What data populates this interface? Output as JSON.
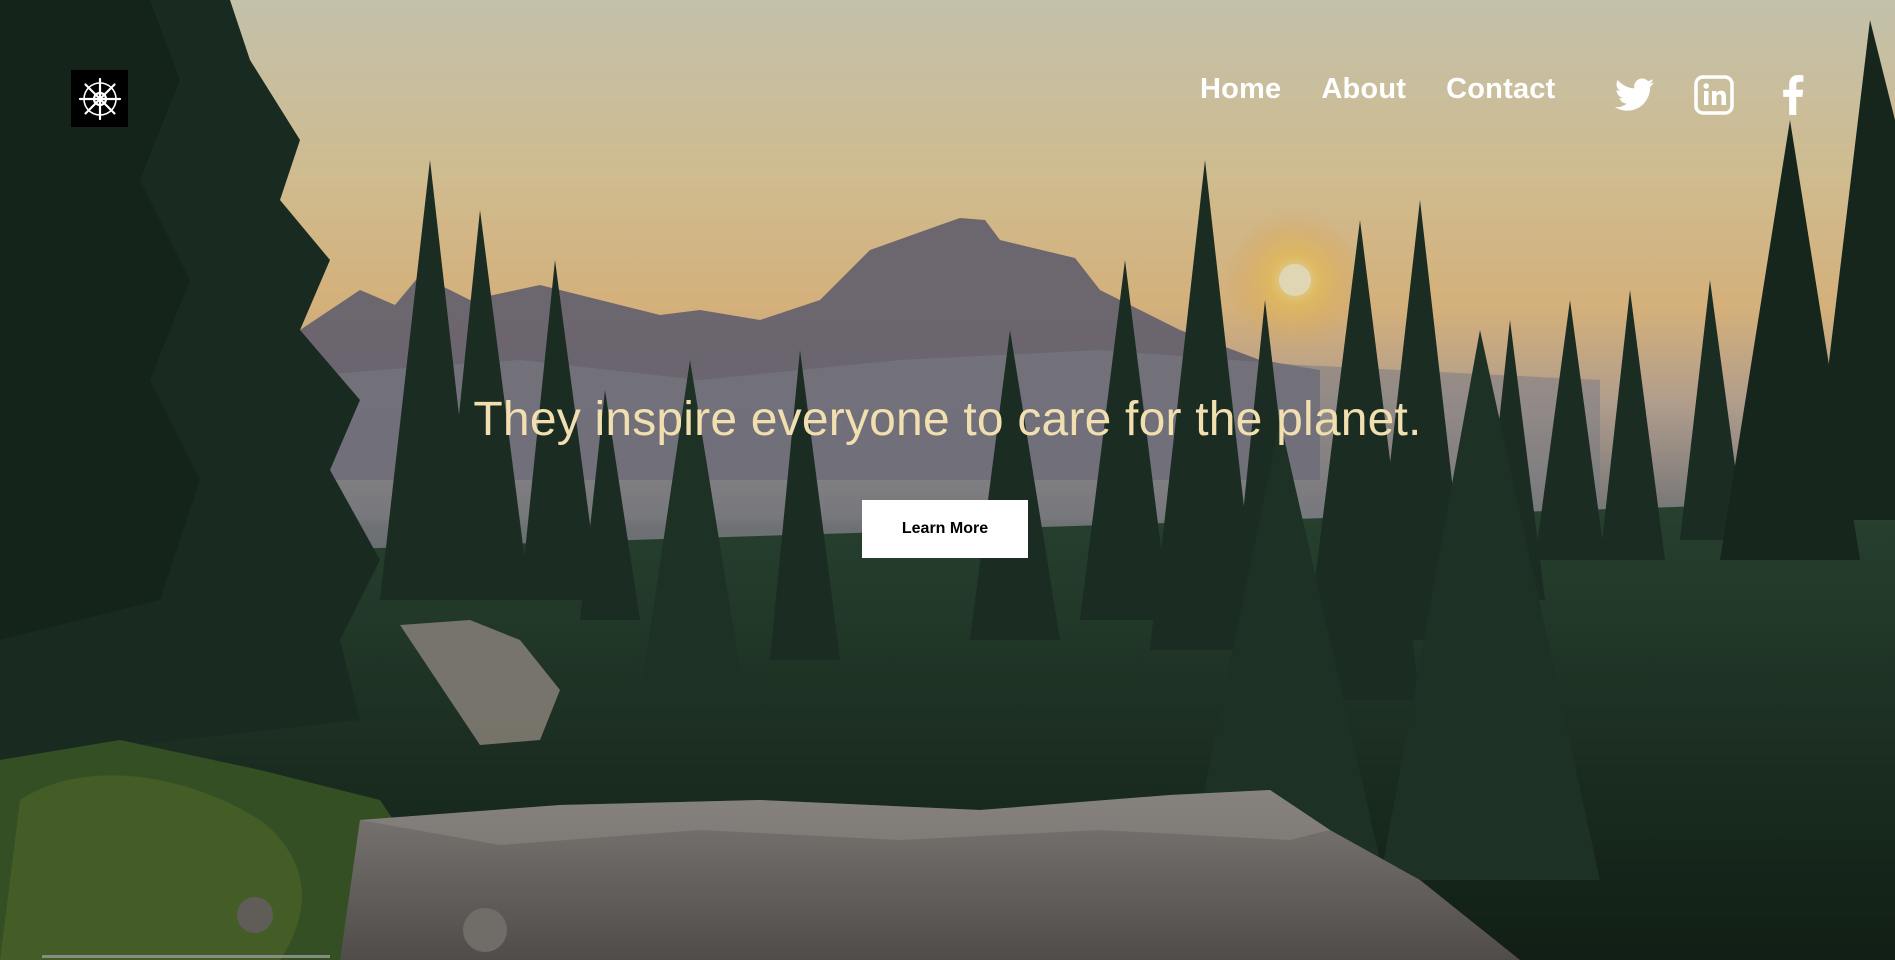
{
  "nav": {
    "links": [
      "Home",
      "About",
      "Contact"
    ]
  },
  "social": {
    "icons": [
      "twitter-icon",
      "linkedin-icon",
      "facebook-icon"
    ]
  },
  "logo": {
    "icon": "snowflake-wheel-logo"
  },
  "hero": {
    "headline": "They inspire everyone to care for the planet.",
    "cta_label": "Learn More"
  },
  "colors": {
    "headline": "#f1dfb0",
    "nav_text": "#ffffff",
    "button_bg": "#ffffff",
    "button_text": "#000000",
    "sky_top": "#dcdcc0",
    "sky_mid": "#f0c98a",
    "forest_dark": "#18291f"
  }
}
